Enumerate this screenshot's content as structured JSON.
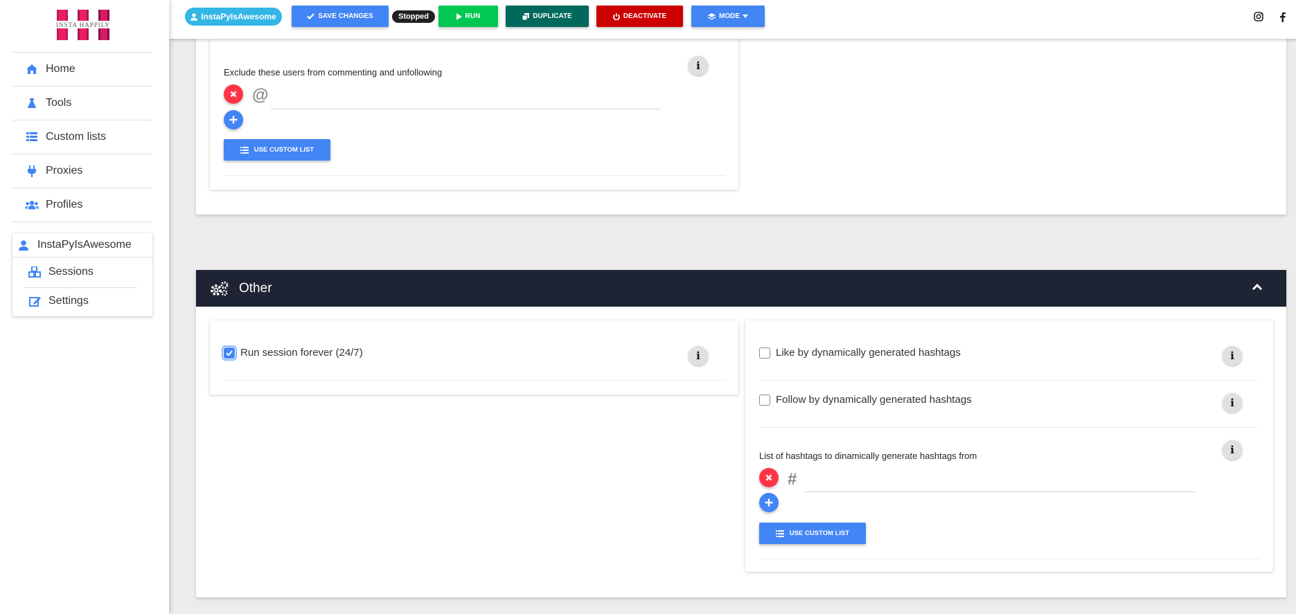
{
  "brand": {
    "logo_text": "INSTA HAPPILY"
  },
  "sidebar": {
    "items": [
      {
        "label": "Home",
        "icon": "home-icon"
      },
      {
        "label": "Tools",
        "icon": "flask-icon"
      },
      {
        "label": "Custom lists",
        "icon": "list-icon"
      },
      {
        "label": "Proxies",
        "icon": "plug-icon"
      },
      {
        "label": "Profiles",
        "icon": "users-icon"
      }
    ],
    "profile": {
      "name": "InstaPyIsAwesome",
      "sub_items": [
        {
          "label": "Sessions",
          "icon": "cubes-icon"
        },
        {
          "label": "Settings",
          "icon": "edit-icon"
        }
      ]
    }
  },
  "topbar": {
    "user": "InstaPyIsAwesome",
    "save": "SAVE CHANGES",
    "status": "Stopped",
    "run": "RUN",
    "duplicate": "DUPLICATE",
    "deactivate": "DEACTIVATE",
    "mode": "MODE",
    "colors": {
      "save": "#4285f4",
      "run": "#00c851",
      "duplicate": "#00695c",
      "deactivate": "#cc0000",
      "mode": "#4285f4",
      "user": "#33b5e5"
    }
  },
  "exclude_card": {
    "label": "Exclude these users from commenting and unfollowing",
    "prefix": "@",
    "input_value": "",
    "custom_list_button": "USE CUSTOM LIST"
  },
  "other_section": {
    "title": "Other",
    "run_forever": {
      "label": "Run session forever (24/7)",
      "checked": true
    },
    "like_dynamic": {
      "label": "Like by dynamically generated hashtags",
      "checked": false
    },
    "follow_dynamic": {
      "label": "Follow by dynamically generated hashtags",
      "checked": false
    },
    "hashtag_list": {
      "label": "List of hashtags to dinamically generate hashtags from",
      "prefix": "#",
      "input_value": "",
      "custom_list_button": "USE CUSTOM LIST"
    }
  },
  "info_symbol": "i"
}
